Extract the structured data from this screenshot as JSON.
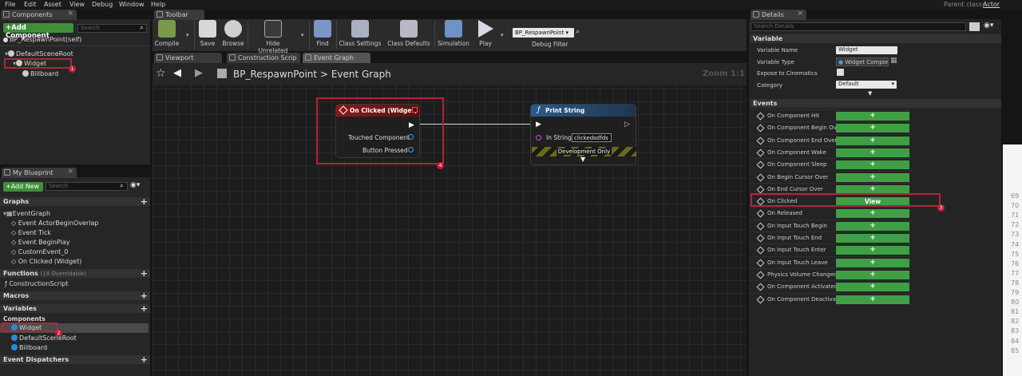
{
  "menu": {
    "items": [
      "File",
      "Edit",
      "Asset",
      "View",
      "Debug",
      "Window",
      "Help"
    ],
    "parent_class_label": "Parent class:",
    "parent_class_value": "Actor"
  },
  "components_panel": {
    "tab": "Components",
    "add_button": "+Add Component",
    "search_placeholder": "Search",
    "self_item": "BP_RespawnPoint(self)",
    "tree": [
      "DefaultSceneRoot",
      "Widget",
      "Billboard"
    ]
  },
  "my_blueprint": {
    "tab": "My Blueprint",
    "add_button": "+Add New",
    "search_placeholder": "Search",
    "graphs_header": "Graphs",
    "event_graph": "EventGraph",
    "events": [
      "Event ActorBeginOverlap",
      "Event Tick",
      "Event BeginPlay",
      "CustomEvent_0",
      "On Clicked (Widget)"
    ],
    "functions_header": "Functions",
    "functions_count": "(18 Overridable)",
    "construction_script": "ConstructionScript",
    "macros_header": "Macros",
    "variables_header": "Variables",
    "components_header": "Components",
    "components": [
      "Widget",
      "DefaultSceneRoot",
      "Billboard"
    ],
    "dispatchers_header": "Event Dispatchers"
  },
  "toolbar": {
    "tab": "Toolbar",
    "buttons": [
      "Compile",
      "Save",
      "Browse",
      "Hide Unrelated",
      "Find",
      "Class Settings",
      "Class Defaults",
      "Simulation",
      "Play"
    ],
    "debug_object": "BP_RespawnPoint",
    "debug_filter": "Debug Filter"
  },
  "editor_tabs": [
    "Viewport",
    "Construction Scrip",
    "Event Graph"
  ],
  "graph": {
    "breadcrumb_root": "BP_RespawnPoint",
    "breadcrumb_sep": ">",
    "breadcrumb_leaf": "Event Graph",
    "zoom": "Zoom 1:1",
    "event_node": {
      "title": "On Clicked (Widget)",
      "pins": [
        "Touched Component",
        "Button Pressed"
      ]
    },
    "print_node": {
      "title": "Print String",
      "in_string_label": "In String",
      "in_string_value": "clickedsdfds",
      "dev_only": "Development Only"
    }
  },
  "details": {
    "tab": "Details",
    "search_placeholder": "Search Details",
    "variable_header": "Variable",
    "fields": [
      {
        "label": "Variable Name",
        "value": "Widget"
      },
      {
        "label": "Variable Type",
        "value": "Widget Compor"
      },
      {
        "label": "Expose to Cinematics",
        "value": ""
      },
      {
        "label": "Category",
        "value": "Default"
      }
    ],
    "events_header": "Events",
    "events": [
      "On Component Hit",
      "On Component Begin Ove",
      "On Component End Overla",
      "On Component Wake",
      "On Component Sleep",
      "On Begin Cursor Over",
      "On End Cursor Over",
      "On Clicked",
      "On Released",
      "On Input Touch Begin",
      "On Input Touch End",
      "On Input Touch Enter",
      "On Input Touch Leave",
      "Physics Volume Changed",
      "On Component Activated",
      "On Component Deactivate"
    ],
    "add_symbol": "+",
    "view_label": "View"
  },
  "badges": [
    "1",
    "2",
    "3",
    "4"
  ],
  "side_numbers": [
    "69",
    "70",
    "71",
    "72",
    "73",
    "74",
    "75",
    "76",
    "77",
    "78",
    "79",
    "80",
    "81",
    "82",
    "83",
    "84",
    "85"
  ],
  "colors": {
    "accent_green": "#3f9f44",
    "highlight_red": "#b3243a",
    "event_node_header": "#8a1a1a",
    "function_node_header": "#2a5a8a"
  }
}
